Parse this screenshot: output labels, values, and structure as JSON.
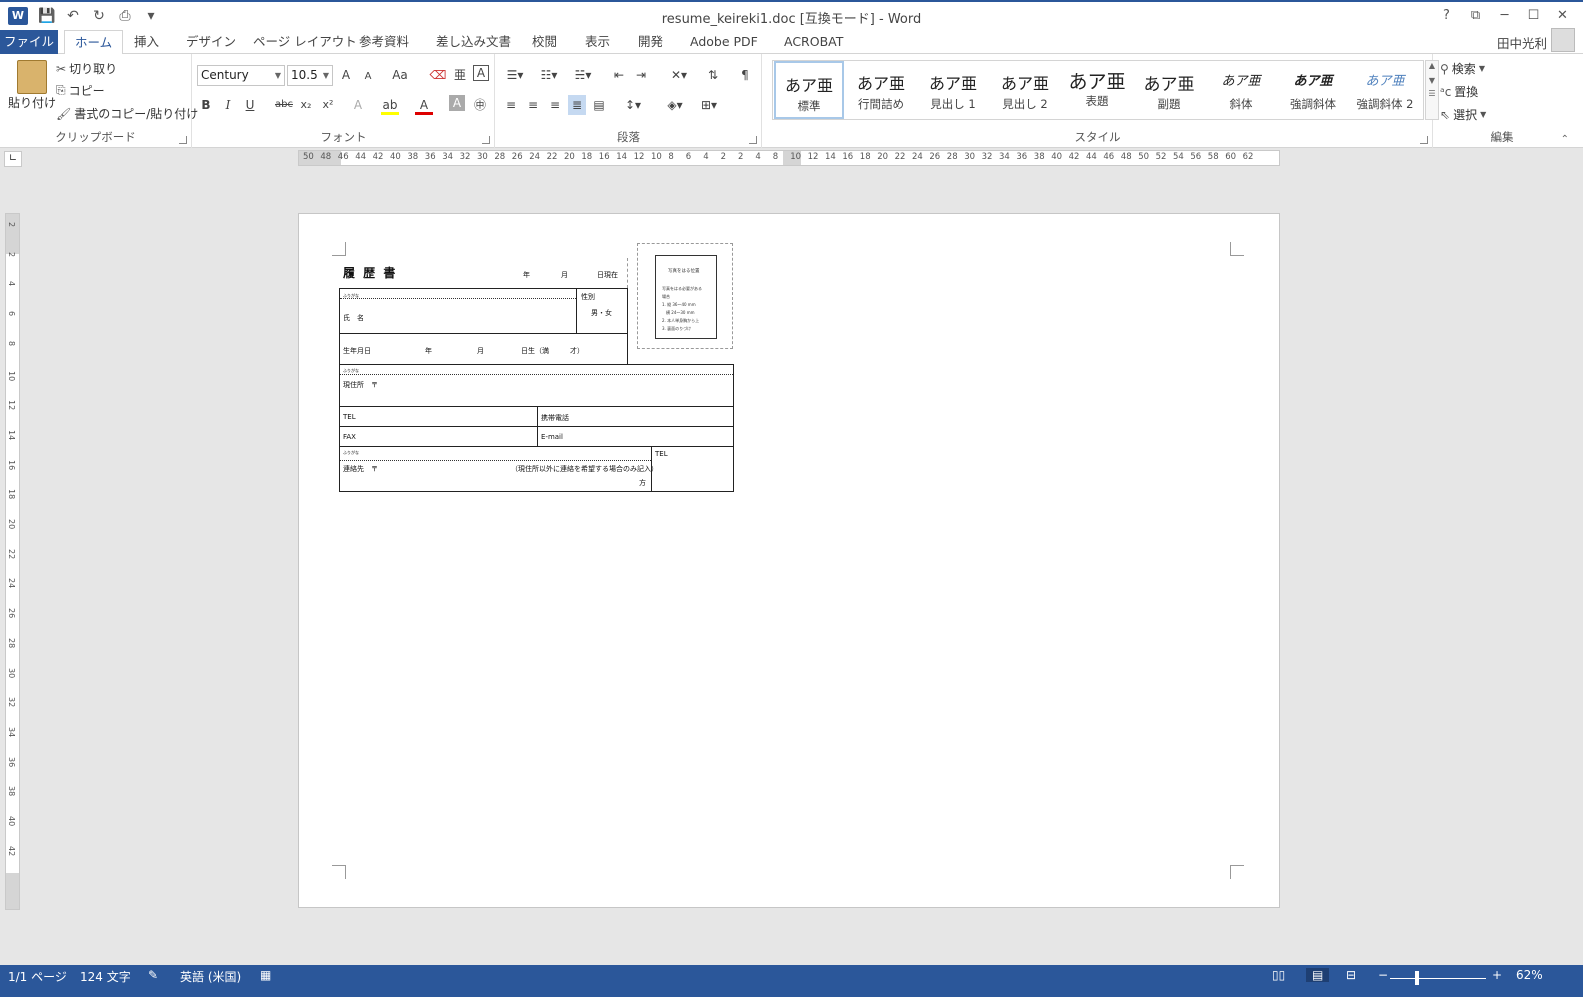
{
  "app": {
    "logo": "W",
    "title": "resume_keireki1.doc [互換モード] - Word",
    "user": "田中光利"
  },
  "window_controls": {
    "help": "?",
    "restore_ribbon": "⧉",
    "minimize": "─",
    "maximize": "☐",
    "close": "✕"
  },
  "tabs": [
    {
      "label": "ファイル"
    },
    {
      "label": "ホーム"
    },
    {
      "label": "挿入"
    },
    {
      "label": "デザイン"
    },
    {
      "label": "ページ レイアウト"
    },
    {
      "label": "参考資料"
    },
    {
      "label": "差し込み文書"
    },
    {
      "label": "校閲"
    },
    {
      "label": "表示"
    },
    {
      "label": "開発"
    },
    {
      "label": "Adobe PDF"
    },
    {
      "label": "ACROBAT"
    }
  ],
  "clipboard": {
    "paste": "貼り付け",
    "cut": "切り取り",
    "copy": "コピー",
    "format_painter": "書式のコピー/貼り付け",
    "label": "クリップボード"
  },
  "font": {
    "name": "Century",
    "size": "10.5",
    "grow": "A",
    "shrink": "A",
    "change_case": "Aa",
    "bold": "B",
    "italic": "I",
    "underline": "U",
    "strike": "abc",
    "sub": "x₂",
    "sup": "x²",
    "label": "フォント"
  },
  "paragraph": {
    "label": "段落"
  },
  "styles": {
    "items": [
      {
        "sample": "あア亜",
        "name": "標準"
      },
      {
        "sample": "あア亜",
        "name": "行間詰め"
      },
      {
        "sample": "あア亜",
        "name": "見出し 1"
      },
      {
        "sample": "あア亜",
        "name": "見出し 2"
      },
      {
        "sample": "あア亜",
        "name": "表題"
      },
      {
        "sample": "あア亜",
        "name": "副題"
      },
      {
        "sample": "あア亜",
        "name": "斜体"
      },
      {
        "sample": "あア亜",
        "name": "強調斜体"
      },
      {
        "sample": "あア亜",
        "name": "強調斜体 2"
      }
    ],
    "label": "スタイル"
  },
  "editing": {
    "find": "検索",
    "replace": "置換",
    "select": "選択",
    "label": "編集"
  },
  "ruler": {
    "h_ticks": [
      "50",
      "48",
      "46",
      "44",
      "42",
      "40",
      "38",
      "36",
      "34",
      "32",
      "30",
      "28",
      "26",
      "24",
      "22",
      "20",
      "18",
      "16",
      "14",
      "12",
      "10",
      "8",
      "6",
      "4",
      "2",
      "2",
      "4",
      "8",
      "10",
      "12",
      "14",
      "16",
      "18",
      "20",
      "22",
      "24",
      "26",
      "28",
      "30",
      "32",
      "34",
      "36",
      "38",
      "40",
      "42",
      "44",
      "46",
      "48",
      "50",
      "52",
      "54",
      "56",
      "58",
      "60",
      "62"
    ],
    "v_ticks": [
      "2",
      "2",
      "4",
      "6",
      "8",
      "10",
      "12",
      "14",
      "16",
      "18",
      "20",
      "22",
      "24",
      "26",
      "28",
      "30",
      "32",
      "34",
      "36",
      "38",
      "40",
      "42"
    ]
  },
  "resume": {
    "title": "履 歴 書",
    "year": "年",
    "month": "月",
    "date_now": "日現在",
    "furigana": "ふりがな",
    "name": "氏　名",
    "gender_label": "性別",
    "gender": "男・女",
    "birth": "生年月日",
    "birth_year": "年",
    "birth_month": "月",
    "birth_day": "日生（満　　　才）",
    "furigana2": "ふりがな",
    "address": "現住所　〒",
    "tel": "TEL",
    "mobile": "携帯電話",
    "fax": "FAX",
    "email": "E-mail",
    "furigana3": "ふりがな",
    "contact": "連絡先　〒",
    "contact_note": "（現住所以外に連絡を希望する場合のみ記入）",
    "contact_suffix": "方",
    "tel2": "TEL",
    "photo_title": "写真をはる位置",
    "photo_lines": [
      "写真をはる必要がある",
      "場合",
      "1. 縦 36～40 mm",
      "　横 24～30 mm",
      "2. 本人単身胸から上",
      "3. 裏面のりづけ"
    ]
  },
  "status": {
    "page": "1/1 ページ",
    "words": "124 文字",
    "lang": "英語 (米国)",
    "zoom": "62%"
  }
}
